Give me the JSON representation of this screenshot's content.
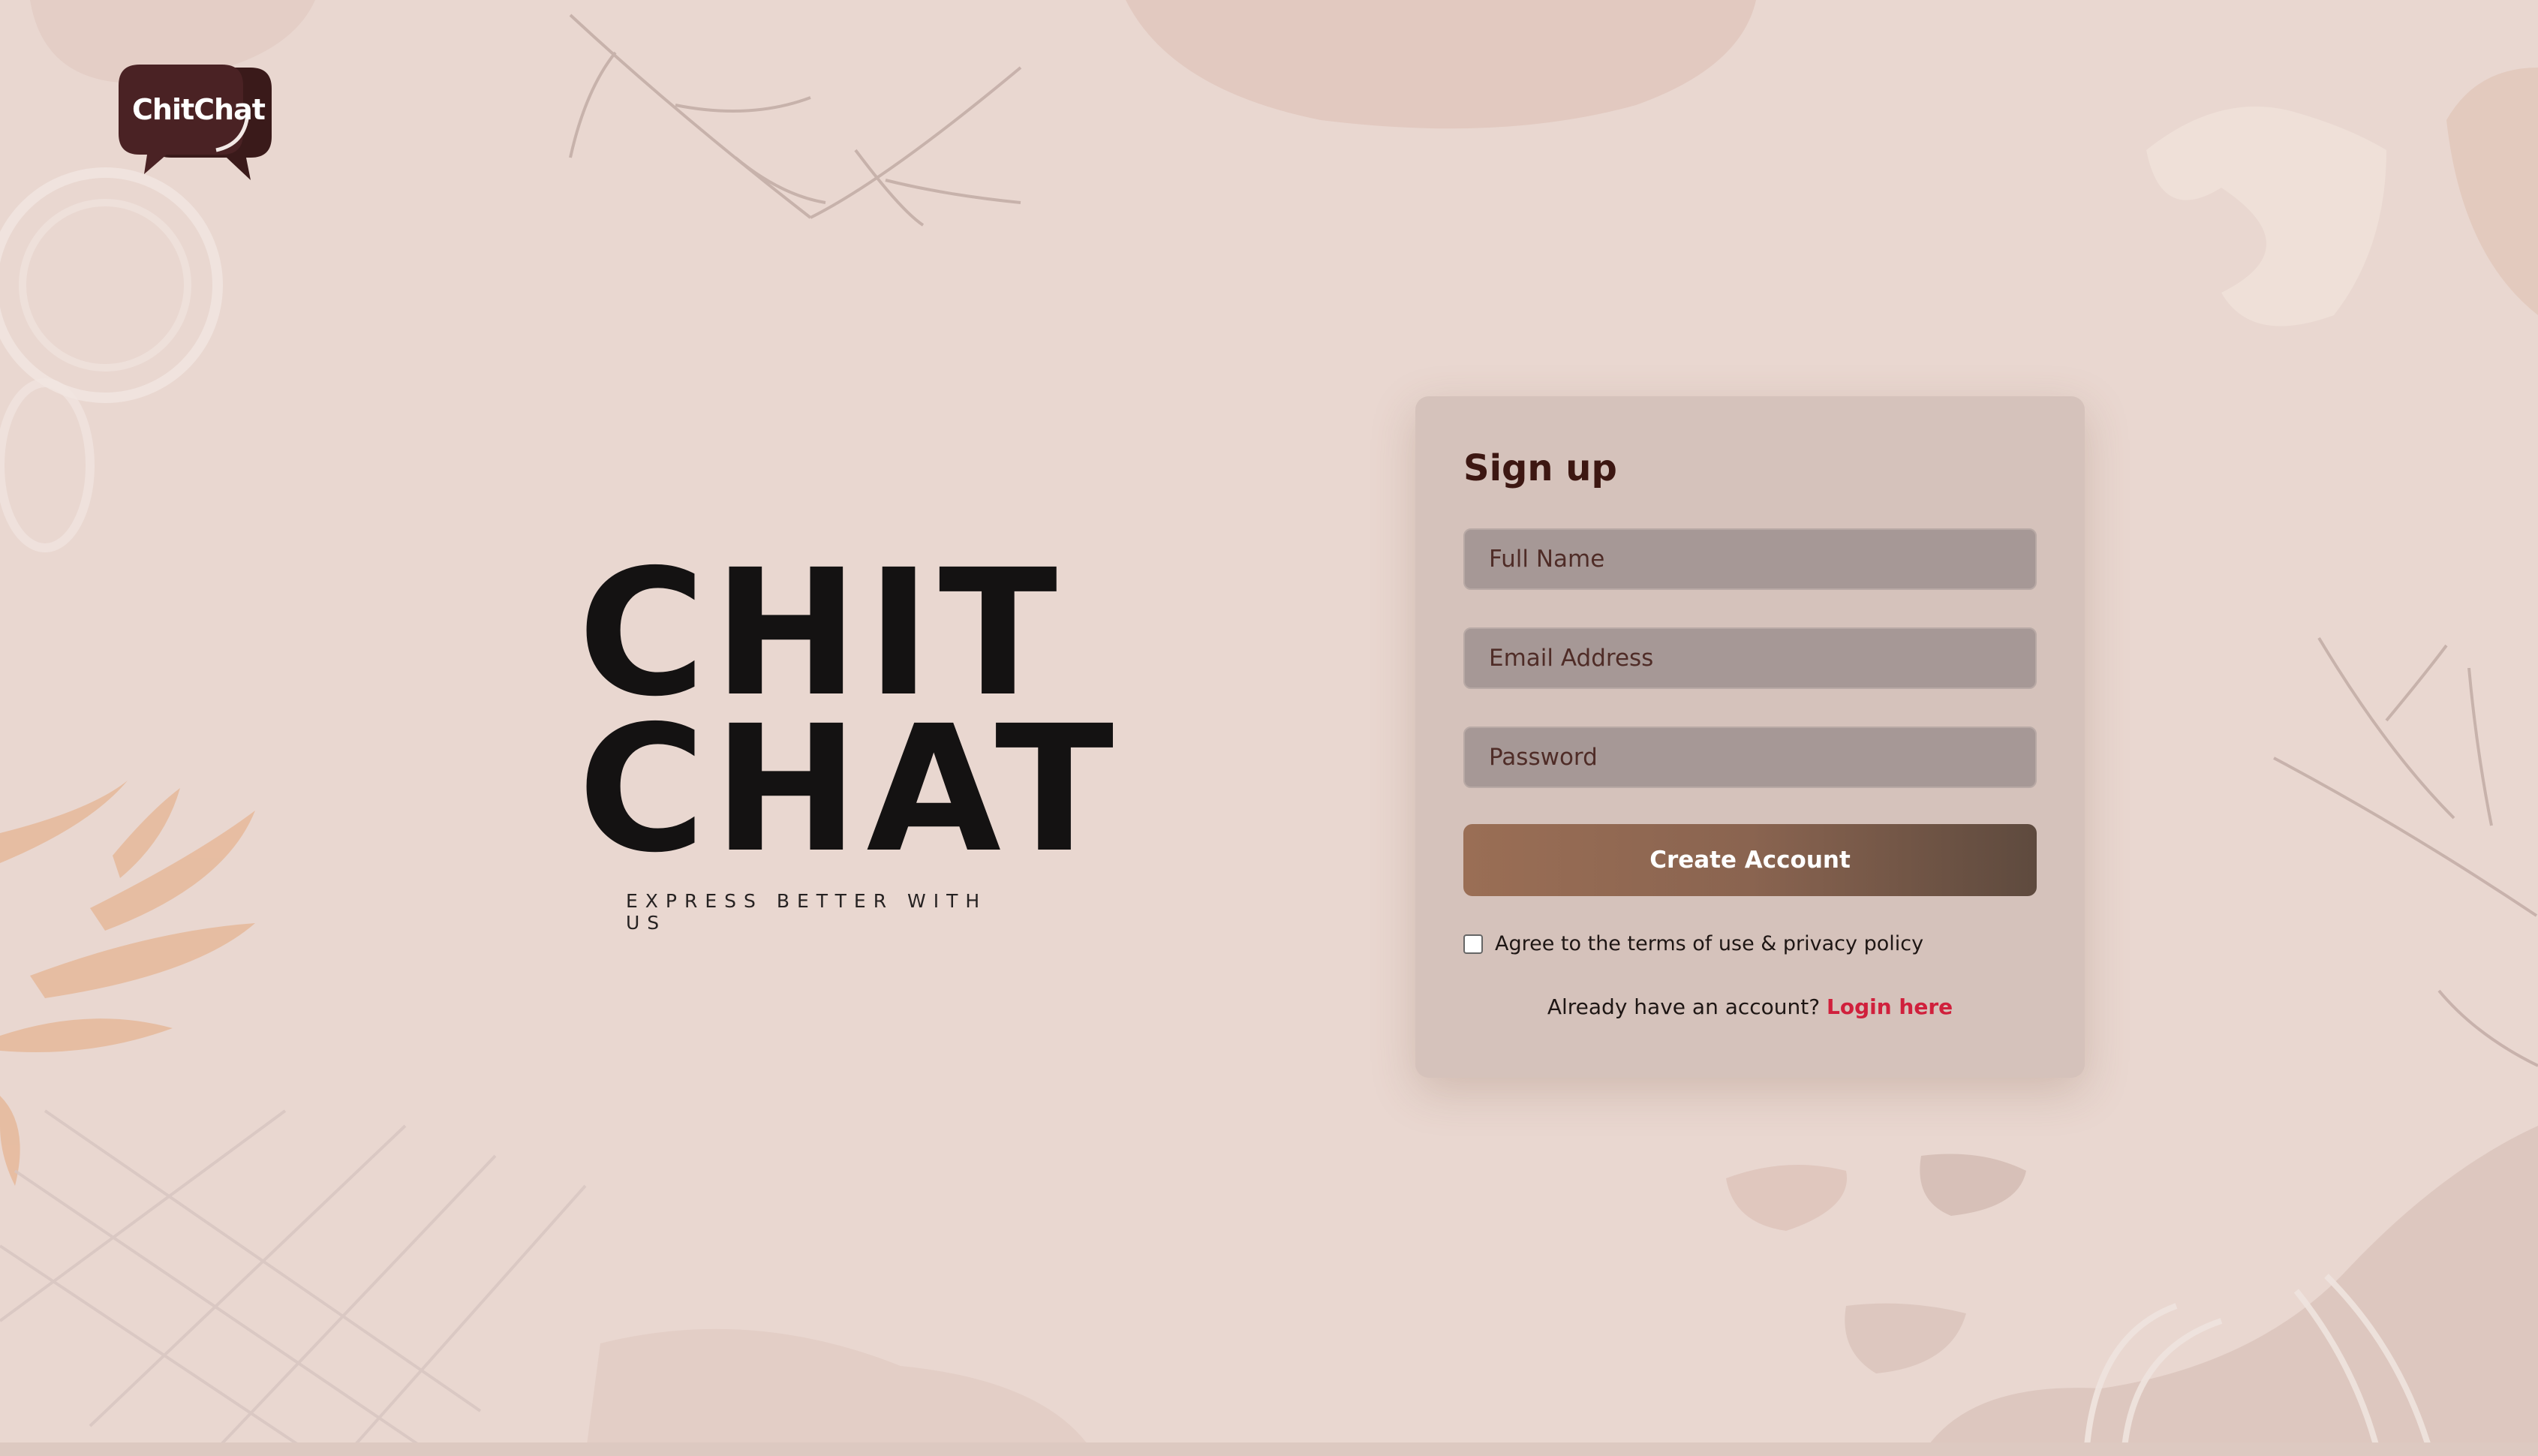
{
  "logo": {
    "text": "ChitChat",
    "icon": "chat-bubbles-icon"
  },
  "brand": {
    "line1": "CHIT",
    "line2": "CHAT",
    "tagline": "EXPRESS BETTER WITH US"
  },
  "signup": {
    "title": "Sign up",
    "full_name_placeholder": "Full Name",
    "email_placeholder": "Email Address",
    "password_placeholder": "Password",
    "submit_label": "Create Account",
    "terms_label": "Agree to the terms of use & privacy policy",
    "terms_checked": false,
    "login_prompt": "Already have an account?",
    "login_link": "Login here"
  },
  "colors": {
    "background": "#e9d7d0",
    "card": "#d5c2bb",
    "title": "#3d1712",
    "link": "#d0203c",
    "button_start": "#9a6e55",
    "button_end": "#5e4a3e"
  }
}
